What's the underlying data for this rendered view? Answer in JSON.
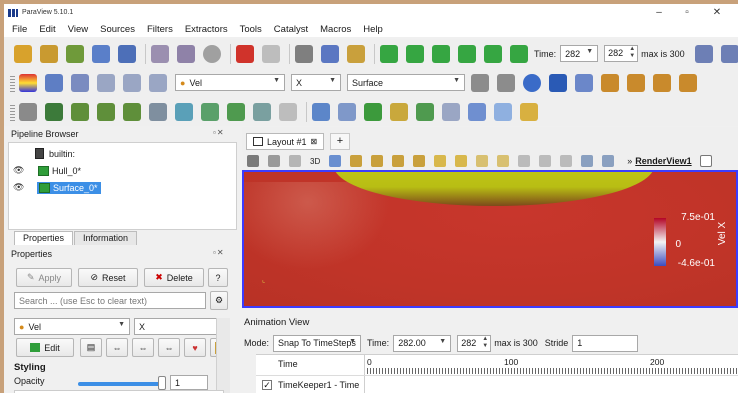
{
  "window": {
    "title": "ParaView 5.10.1",
    "min_icon": "minimize-icon",
    "max_icon": "maximize-icon",
    "close_icon": "close-icon",
    "min_glyph": "–",
    "max_glyph": "▫",
    "close_glyph": "✕"
  },
  "menu": [
    "File",
    "Edit",
    "View",
    "Sources",
    "Filters",
    "Extractors",
    "Tools",
    "Catalyst",
    "Macros",
    "Help"
  ],
  "time_toolbar": {
    "time_label": "Time:",
    "time_value": "282",
    "index_value": "282",
    "max_label": "max is 300"
  },
  "display_toolbar": {
    "array": "Vel",
    "component": "X",
    "representation": "Surface"
  },
  "pipeline": {
    "title": "Pipeline Browser",
    "items": [
      {
        "label": "builtin:"
      },
      {
        "label": "Hull_0*"
      },
      {
        "label": "Surface_0*"
      }
    ]
  },
  "properties": {
    "tabs": [
      "Properties",
      "Information"
    ],
    "title": "Properties",
    "apply": "Apply",
    "reset": "Reset",
    "delete": "Delete",
    "help": "?",
    "search_placeholder": "Search ... (use Esc to clear text)",
    "color_array": "Vel",
    "color_component": "X",
    "edit": "Edit",
    "styling": "Styling",
    "opacity": "Opacity",
    "opacity_value": 1
  },
  "layout": {
    "tab": "Layout #1",
    "add": "+",
    "view_name": "RenderView1",
    "view_chevron": "»",
    "mode_3d": "3D"
  },
  "colorbar": {
    "max": "7.5e-01",
    "mid": "0",
    "min": "-4.6e-01",
    "title": "Vel X"
  },
  "animation": {
    "title": "Animation View",
    "mode_label": "Mode:",
    "mode": "Snap To TimeSteps",
    "time_label": "Time:",
    "time": "282.00",
    "index": "282",
    "max_label": "max is 300",
    "stride_label": "Stride",
    "stride": "1",
    "col_time": "Time",
    "ticks": [
      "0",
      "100",
      "200"
    ],
    "track": "TimeKeeper1 - Time"
  },
  "colors": {
    "selection": "#3c8fe6",
    "accent_blue": "#3c3cff",
    "field_red": "#c03428",
    "hull_yellow": "#c9cc1a"
  }
}
